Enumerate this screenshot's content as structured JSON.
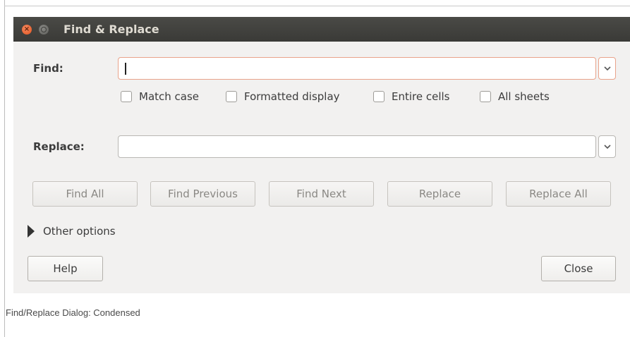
{
  "window": {
    "title": "Find & Replace",
    "close_glyph": "×"
  },
  "find": {
    "label": "Find:",
    "value": "",
    "dropdown_icon": "chevron-down-icon"
  },
  "options": [
    {
      "label": "Match case",
      "checked": false
    },
    {
      "label": "Formatted display",
      "checked": false
    },
    {
      "label": "Entire cells",
      "checked": false
    },
    {
      "label": "All sheets",
      "checked": false
    }
  ],
  "replace": {
    "label": "Replace:",
    "value": "",
    "dropdown_icon": "chevron-down-icon"
  },
  "actions": {
    "find_all": "Find All",
    "find_previous": "Find Previous",
    "find_next": "Find Next",
    "replace": "Replace",
    "replace_all": "Replace All"
  },
  "other_options": {
    "label": "Other options",
    "expanded": false
  },
  "footer": {
    "help": "Help",
    "close": "Close"
  },
  "caption": "Find/Replace Dialog: Condensed",
  "colors": {
    "titlebar": "#3c3b37",
    "dialog_bg": "#f2f1f0",
    "close_button": "#e95420",
    "focus_border": "#e9a38b"
  }
}
